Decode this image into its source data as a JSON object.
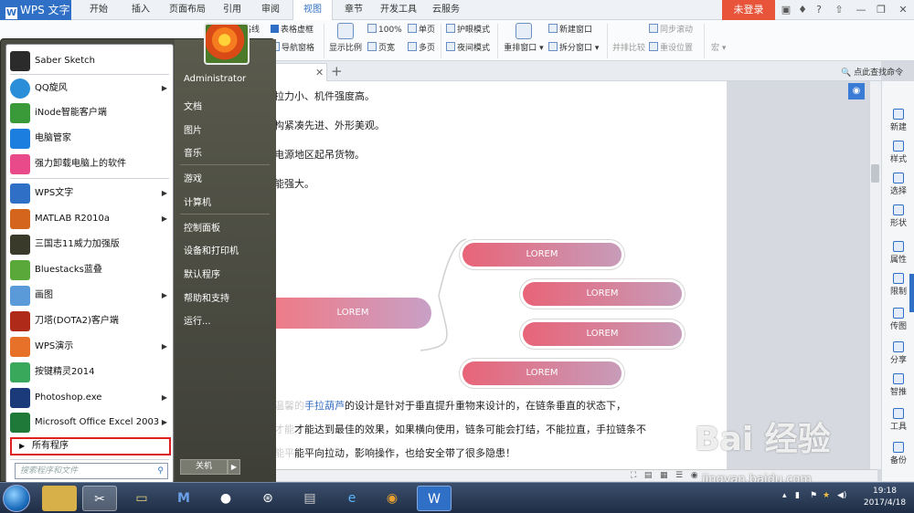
{
  "wps": {
    "app_name": "WPS 文字",
    "tabs": [
      "开始",
      "插入",
      "页面布局",
      "引用",
      "审阅",
      "视图",
      "章节",
      "开发工具",
      "云服务"
    ],
    "active_tab": "视图",
    "login_label": "未登录",
    "ribbon": {
      "grid_label": "格线",
      "table_grid": "表格虚框",
      "nav_pane": "导航窗格",
      "zoom": "显示比例",
      "zoom_100": "100%",
      "page_width": "页宽",
      "single_page": "单页",
      "multi_page": "多页",
      "eye_mode": "护眼模式",
      "night_mode": "夜间模式",
      "arrange": "重排窗口",
      "new_window": "新建窗口",
      "split_window": "拆分窗口",
      "side_by_side": "并排比较",
      "sync_scroll": "同步滚动",
      "reset_pos": "重设位置",
      "macro": "宏"
    },
    "find_placeholder": "点此查找命令",
    "document": {
      "lines": [
        "拉力小、机件强度高。",
        "构紧凑先进、外形美观。",
        "电源地区起吊货物。",
        "能强大。"
      ],
      "para_link": "手拉葫芦",
      "para_line1_after": "的设计是针对于垂直提升重物来设计的，在链条垂直的状态下，",
      "para_line2": "才能达到最佳的效果，如果横向使用，链条可能会打结，不能拉直，手拉链条不",
      "para_line3": "能平向拉动，影响操作，也给安全带了很多隐患！",
      "para_prefix1": "温馨的",
      "para_prefix2": "才能",
      "para_prefix3": "能平"
    },
    "mindmap": {
      "main": "LOREM",
      "children": [
        "LOREM",
        "LOREM",
        "LOREM",
        "LOREM"
      ]
    },
    "taskpane": [
      "新建",
      "样式",
      "选择",
      "形状",
      "属性",
      "限制",
      "传图",
      "分享",
      "智推",
      "工具",
      "备份"
    ]
  },
  "startmenu": {
    "programs": [
      {
        "label": "Saber Sketch",
        "color": "#2b2b2b",
        "arrow": false
      },
      {
        "label": "QQ旋风",
        "color": "#2a8fd8",
        "arrow": true
      },
      {
        "label": "iNode智能客户端",
        "color": "#3a9a3a",
        "arrow": false
      },
      {
        "label": "电脑管家",
        "color": "#1c7fe0",
        "arrow": false
      },
      {
        "label": "强力卸载电脑上的软件",
        "color": "#e84a8a",
        "arrow": false
      },
      {
        "label": "WPS文字",
        "color": "#2f6fc6",
        "arrow": true
      },
      {
        "label": "MATLAB R2010a",
        "color": "#d4651c",
        "arrow": true
      },
      {
        "label": "三国志11威力加强版",
        "color": "#3a3a2a",
        "arrow": false
      },
      {
        "label": "Bluestacks蓝叠",
        "color": "#5aa83a",
        "arrow": false
      },
      {
        "label": "画图",
        "color": "#5b9ad8",
        "arrow": true
      },
      {
        "label": "刀塔(DOTA2)客户端",
        "color": "#b02a1a",
        "arrow": false
      },
      {
        "label": "WPS演示",
        "color": "#e8712a",
        "arrow": true
      },
      {
        "label": "按键精灵2014",
        "color": "#3aa85a",
        "arrow": false
      },
      {
        "label": "Photoshop.exe",
        "color": "#1a3a7a",
        "arrow": true
      },
      {
        "label": "Microsoft Office Excel 2003",
        "color": "#1f7a3a",
        "arrow": true
      }
    ],
    "all_programs": "所有程序",
    "search_placeholder": "搜索程序和文件",
    "right": [
      "Administrator",
      "文档",
      "图片",
      "音乐",
      "游戏",
      "计算机",
      "控制面板",
      "设备和打印机",
      "默认程序",
      "帮助和支持",
      "运行..."
    ],
    "shutdown": "关机"
  },
  "taskbar": {
    "time": "19:18",
    "date": "2017/4/18"
  },
  "watermark": {
    "logo": "Bai 经验",
    "url": "jingyan.baidu.com"
  }
}
